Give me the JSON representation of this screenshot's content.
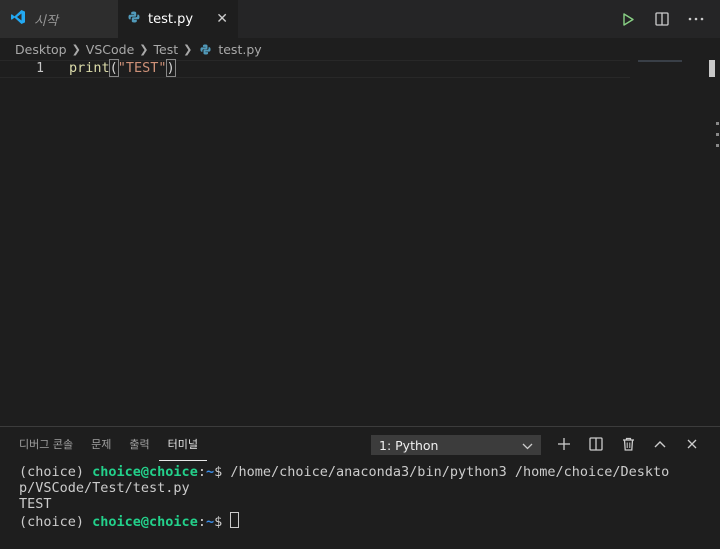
{
  "tabs": [
    {
      "label": "시작",
      "active": false
    },
    {
      "label": "test.py",
      "active": true
    }
  ],
  "breadcrumb": [
    "Desktop",
    "VSCode",
    "Test",
    "test.py"
  ],
  "editor": {
    "line_number": "1",
    "code": {
      "fn": "print",
      "open": "(",
      "str": "\"TEST\"",
      "close": ")"
    }
  },
  "panel": {
    "tabs": [
      "디버그 콘솔",
      "문제",
      "출력",
      "터미널"
    ],
    "active_tab": "터미널",
    "terminal_select": "1: Python"
  },
  "terminal": {
    "prompt_env": "(choice) ",
    "user": "choice@choice",
    "colon": ":",
    "path": "~",
    "dollar": "$ ",
    "command_line1": "/home/choice/anaconda3/bin/python3 /home/choice/Deskto",
    "command_line2": "p/VSCode/Test/test.py",
    "output": "TEST"
  },
  "colors": {
    "accent_vscode": "#23a9f2",
    "run": "#89d185",
    "python_icon": "#519aba"
  }
}
